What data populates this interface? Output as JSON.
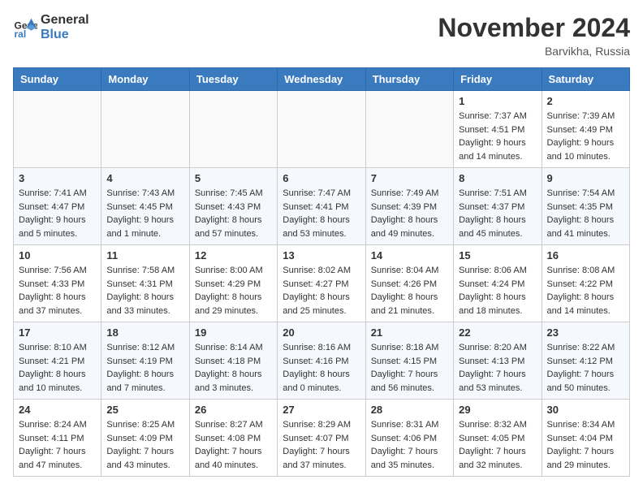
{
  "header": {
    "logo_line1": "General",
    "logo_line2": "Blue",
    "month_title": "November 2024",
    "location": "Barvikha, Russia"
  },
  "calendar": {
    "weekdays": [
      "Sunday",
      "Monday",
      "Tuesday",
      "Wednesday",
      "Thursday",
      "Friday",
      "Saturday"
    ],
    "weeks": [
      [
        {
          "day": "",
          "info": ""
        },
        {
          "day": "",
          "info": ""
        },
        {
          "day": "",
          "info": ""
        },
        {
          "day": "",
          "info": ""
        },
        {
          "day": "",
          "info": ""
        },
        {
          "day": "1",
          "info": "Sunrise: 7:37 AM\nSunset: 4:51 PM\nDaylight: 9 hours\nand 14 minutes."
        },
        {
          "day": "2",
          "info": "Sunrise: 7:39 AM\nSunset: 4:49 PM\nDaylight: 9 hours\nand 10 minutes."
        }
      ],
      [
        {
          "day": "3",
          "info": "Sunrise: 7:41 AM\nSunset: 4:47 PM\nDaylight: 9 hours\nand 5 minutes."
        },
        {
          "day": "4",
          "info": "Sunrise: 7:43 AM\nSunset: 4:45 PM\nDaylight: 9 hours\nand 1 minute."
        },
        {
          "day": "5",
          "info": "Sunrise: 7:45 AM\nSunset: 4:43 PM\nDaylight: 8 hours\nand 57 minutes."
        },
        {
          "day": "6",
          "info": "Sunrise: 7:47 AM\nSunset: 4:41 PM\nDaylight: 8 hours\nand 53 minutes."
        },
        {
          "day": "7",
          "info": "Sunrise: 7:49 AM\nSunset: 4:39 PM\nDaylight: 8 hours\nand 49 minutes."
        },
        {
          "day": "8",
          "info": "Sunrise: 7:51 AM\nSunset: 4:37 PM\nDaylight: 8 hours\nand 45 minutes."
        },
        {
          "day": "9",
          "info": "Sunrise: 7:54 AM\nSunset: 4:35 PM\nDaylight: 8 hours\nand 41 minutes."
        }
      ],
      [
        {
          "day": "10",
          "info": "Sunrise: 7:56 AM\nSunset: 4:33 PM\nDaylight: 8 hours\nand 37 minutes."
        },
        {
          "day": "11",
          "info": "Sunrise: 7:58 AM\nSunset: 4:31 PM\nDaylight: 8 hours\nand 33 minutes."
        },
        {
          "day": "12",
          "info": "Sunrise: 8:00 AM\nSunset: 4:29 PM\nDaylight: 8 hours\nand 29 minutes."
        },
        {
          "day": "13",
          "info": "Sunrise: 8:02 AM\nSunset: 4:27 PM\nDaylight: 8 hours\nand 25 minutes."
        },
        {
          "day": "14",
          "info": "Sunrise: 8:04 AM\nSunset: 4:26 PM\nDaylight: 8 hours\nand 21 minutes."
        },
        {
          "day": "15",
          "info": "Sunrise: 8:06 AM\nSunset: 4:24 PM\nDaylight: 8 hours\nand 18 minutes."
        },
        {
          "day": "16",
          "info": "Sunrise: 8:08 AM\nSunset: 4:22 PM\nDaylight: 8 hours\nand 14 minutes."
        }
      ],
      [
        {
          "day": "17",
          "info": "Sunrise: 8:10 AM\nSunset: 4:21 PM\nDaylight: 8 hours\nand 10 minutes."
        },
        {
          "day": "18",
          "info": "Sunrise: 8:12 AM\nSunset: 4:19 PM\nDaylight: 8 hours\nand 7 minutes."
        },
        {
          "day": "19",
          "info": "Sunrise: 8:14 AM\nSunset: 4:18 PM\nDaylight: 8 hours\nand 3 minutes."
        },
        {
          "day": "20",
          "info": "Sunrise: 8:16 AM\nSunset: 4:16 PM\nDaylight: 8 hours\nand 0 minutes."
        },
        {
          "day": "21",
          "info": "Sunrise: 8:18 AM\nSunset: 4:15 PM\nDaylight: 7 hours\nand 56 minutes."
        },
        {
          "day": "22",
          "info": "Sunrise: 8:20 AM\nSunset: 4:13 PM\nDaylight: 7 hours\nand 53 minutes."
        },
        {
          "day": "23",
          "info": "Sunrise: 8:22 AM\nSunset: 4:12 PM\nDaylight: 7 hours\nand 50 minutes."
        }
      ],
      [
        {
          "day": "24",
          "info": "Sunrise: 8:24 AM\nSunset: 4:11 PM\nDaylight: 7 hours\nand 47 minutes."
        },
        {
          "day": "25",
          "info": "Sunrise: 8:25 AM\nSunset: 4:09 PM\nDaylight: 7 hours\nand 43 minutes."
        },
        {
          "day": "26",
          "info": "Sunrise: 8:27 AM\nSunset: 4:08 PM\nDaylight: 7 hours\nand 40 minutes."
        },
        {
          "day": "27",
          "info": "Sunrise: 8:29 AM\nSunset: 4:07 PM\nDaylight: 7 hours\nand 37 minutes."
        },
        {
          "day": "28",
          "info": "Sunrise: 8:31 AM\nSunset: 4:06 PM\nDaylight: 7 hours\nand 35 minutes."
        },
        {
          "day": "29",
          "info": "Sunrise: 8:32 AM\nSunset: 4:05 PM\nDaylight: 7 hours\nand 32 minutes."
        },
        {
          "day": "30",
          "info": "Sunrise: 8:34 AM\nSunset: 4:04 PM\nDaylight: 7 hours\nand 29 minutes."
        }
      ]
    ]
  }
}
